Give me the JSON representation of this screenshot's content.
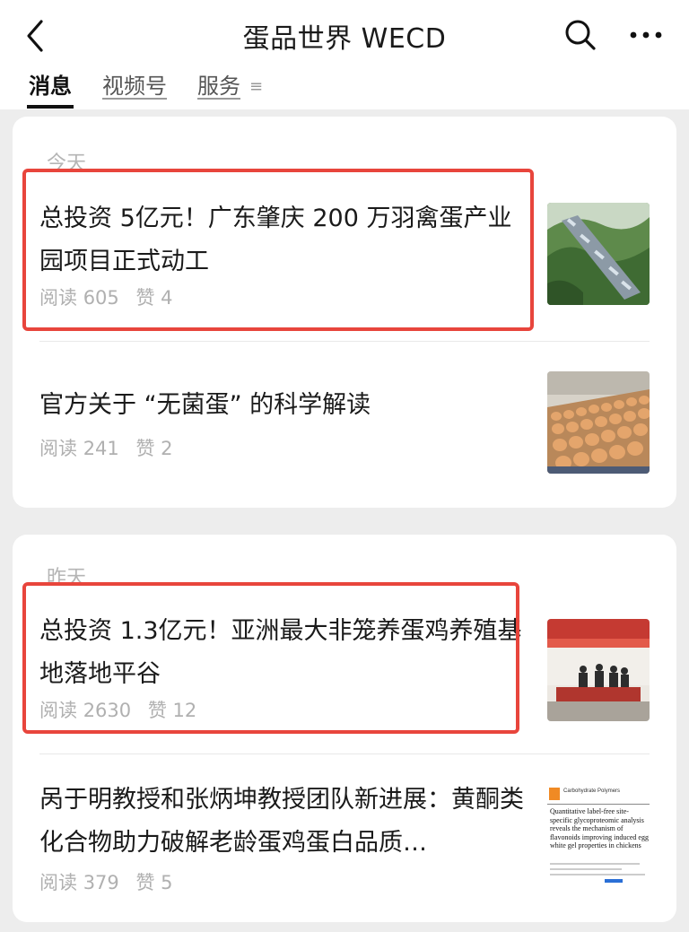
{
  "header": {
    "title": "蛋品世界 WECD",
    "back_icon": "chevron-left-icon",
    "search_icon": "search-icon",
    "more_icon": "more-dots-icon"
  },
  "tabs": [
    {
      "label": "消息",
      "active": true
    },
    {
      "label": "视频号",
      "active": false
    },
    {
      "label": "服务",
      "active": false
    }
  ],
  "tab_menu_icon": "≡",
  "accent_color": "#e8453c",
  "groups": [
    {
      "date": "今天",
      "articles": [
        {
          "title": "总投资 5亿元！广东肇庆 200 万羽禽蛋产业园项目正式动工",
          "reads_label": "阅读",
          "reads": "605",
          "likes_label": "赞",
          "likes": "4",
          "highlighted": true,
          "thumbnail": "aerial-farm-thumbnail"
        },
        {
          "title": "官方关于 “无菌蛋” 的科学解读",
          "reads_label": "阅读",
          "reads": "241",
          "likes_label": "赞",
          "likes": "2",
          "highlighted": false,
          "thumbnail": "egg-conveyor-thumbnail"
        }
      ]
    },
    {
      "date": "昨天",
      "articles": [
        {
          "title": "总投资 1.3亿元！亚洲最大非笼养蛋鸡养殖基地落地平谷",
          "reads_label": "阅读",
          "reads": "2630",
          "likes_label": "赞",
          "likes": "12",
          "highlighted": true,
          "thumbnail": "signing-ceremony-thumbnail"
        },
        {
          "title": "呙于明教授和张炳坤教授团队新进展：黄酮类化合物助力破解老龄蛋鸡蛋白品质…",
          "reads_label": "阅读",
          "reads": "379",
          "likes_label": "赞",
          "likes": "5",
          "highlighted": false,
          "thumbnail": "journal-paper-thumbnail",
          "thumb_text": {
            "journal": "Carbohydrate Polymers",
            "paper_title": "Quantitative label-free site-specific glycoproteomic analysis reveals the mechanism of flavonoids improving induced egg white gel properties in chickens"
          }
        }
      ]
    }
  ]
}
